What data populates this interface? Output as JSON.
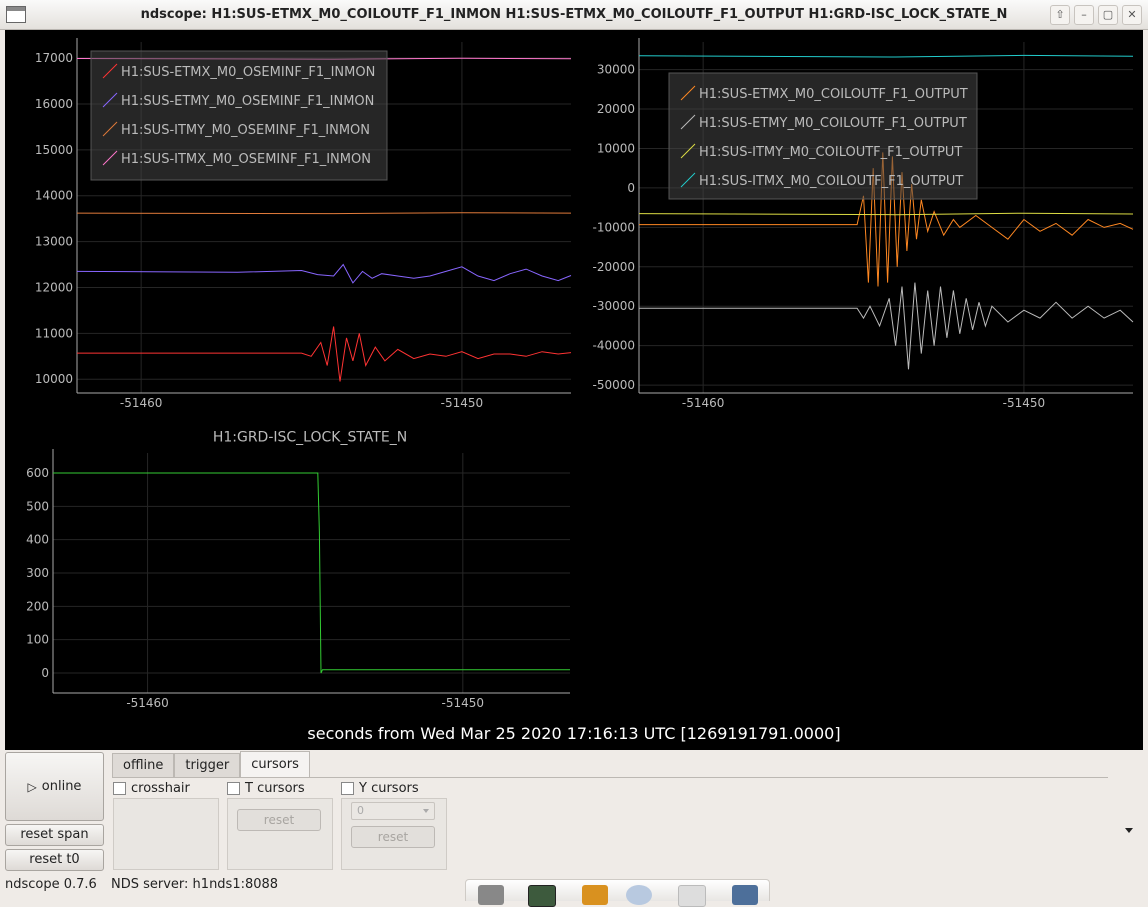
{
  "window": {
    "title": "ndscope: H1:SUS-ETMX_M0_COILOUTF_F1_INMON H1:SUS-ETMX_M0_COILOUTF_F1_OUTPUT H1:GRD-ISC_LOCK_STATE_N",
    "buttons": [
      "up-arrow-icon",
      "minimize-icon",
      "maximize-icon",
      "close-icon"
    ]
  },
  "time_axis_label": "seconds from Wed Mar 25 2020 17:16:13 UTC [1269191791.0000]",
  "controls": {
    "online_label": "online",
    "online_icon": "play-icon",
    "reset_span_label": "reset span",
    "reset_t0_label": "reset t0",
    "tabs": [
      "offline",
      "trigger",
      "cursors"
    ],
    "active_tab": "cursors",
    "crosshair_label": "crosshair",
    "t_cursors_label": "T cursors",
    "y_cursors_label": "Y cursors",
    "t_reset_label": "reset",
    "y_reset_label": "reset",
    "y_select_value": "0"
  },
  "status": {
    "version": "ndscope 0.7.6",
    "server": "NDS server: h1nds1:8088"
  },
  "chart_data": [
    {
      "type": "line",
      "title": "",
      "xlim": [
        -51462,
        -51446.6
      ],
      "ylim": [
        9700,
        17350
      ],
      "xticks": [
        -51460,
        -51450
      ],
      "yticks": [
        10000,
        11000,
        12000,
        13000,
        14000,
        15000,
        16000,
        17000
      ],
      "grid": true,
      "legend": "top-left",
      "series": [
        {
          "name": "H1:SUS-ETMX_M0_OSEMINF_F1_INMON",
          "color": "#ff3333",
          "x": [
            -51462,
            -51455,
            -51454.7,
            -51454.4,
            -51454.2,
            -51454.0,
            -51453.8,
            -51453.6,
            -51453.4,
            -51453.2,
            -51453.0,
            -51452.7,
            -51452.4,
            -51452.0,
            -51451.5,
            -51451.0,
            -51450.5,
            -51450.0,
            -51449.5,
            -51449.0,
            -51448.5,
            -51448.0,
            -51447.5,
            -51447.0,
            -51446.6
          ],
          "y": [
            10570,
            10570,
            10500,
            10800,
            10300,
            11150,
            9950,
            10900,
            10400,
            11000,
            10300,
            10700,
            10400,
            10650,
            10450,
            10550,
            10500,
            10600,
            10450,
            10550,
            10550,
            10500,
            10600,
            10550,
            10580
          ]
        },
        {
          "name": "H1:SUS-ETMY_M0_OSEMINF_F1_INMON",
          "color": "#8866ff",
          "x": [
            -51462,
            -51457,
            -51455,
            -51454.5,
            -51454,
            -51453.7,
            -51453.4,
            -51453.1,
            -51452.8,
            -51452.5,
            -51452,
            -51451.5,
            -51451,
            -51450.5,
            -51450,
            -51449.5,
            -51449,
            -51448.5,
            -51448,
            -51447.5,
            -51447,
            -51446.6
          ],
          "y": [
            12350,
            12330,
            12370,
            12280,
            12250,
            12500,
            12100,
            12350,
            12200,
            12300,
            12250,
            12200,
            12250,
            12350,
            12450,
            12250,
            12150,
            12300,
            12400,
            12250,
            12150,
            12260
          ]
        },
        {
          "name": "H1:SUS-ITMY_M0_OSEMINF_F1_INMON",
          "color": "#e07a3a",
          "x": [
            -51462,
            -51454,
            -51450,
            -51446.6
          ],
          "y": [
            13620,
            13610,
            13630,
            13620
          ]
        },
        {
          "name": "H1:SUS-ITMX_M0_OSEMINF_F1_INMON",
          "color": "#ff77cc",
          "x": [
            -51462,
            -51454,
            -51450,
            -51446.6
          ],
          "y": [
            16990,
            16975,
            16995,
            16985
          ]
        }
      ]
    },
    {
      "type": "line",
      "title": "",
      "xlim": [
        -51462,
        -51446.6
      ],
      "ylim": [
        -52000,
        37000
      ],
      "xticks": [
        -51460,
        -51450
      ],
      "yticks": [
        -50000,
        -40000,
        -30000,
        -20000,
        -10000,
        0,
        10000,
        20000,
        30000
      ],
      "grid": true,
      "legend": "top-left",
      "series": [
        {
          "name": "H1:SUS-ETMX_M0_COILOUTF_F1_OUTPUT",
          "color": "#ff8822",
          "x": [
            -51462,
            -51455.2,
            -51455.0,
            -51454.85,
            -51454.7,
            -51454.55,
            -51454.4,
            -51454.25,
            -51454.1,
            -51453.95,
            -51453.8,
            -51453.65,
            -51453.5,
            -51453.35,
            -51453.2,
            -51453.0,
            -51452.8,
            -51452.5,
            -51452.2,
            -51452.0,
            -51451.5,
            -51451.0,
            -51450.5,
            -51450.0,
            -51449.5,
            -51449.0,
            -51448.5,
            -51448.0,
            -51447.5,
            -51447.0,
            -51446.6
          ],
          "y": [
            -9300,
            -9300,
            -2000,
            -24000,
            5000,
            -25000,
            9000,
            -24000,
            8000,
            -20000,
            4000,
            -16000,
            1000,
            -13000,
            -3000,
            -11000,
            -6000,
            -12000,
            -8000,
            -10000,
            -7000,
            -10000,
            -13000,
            -8000,
            -11000,
            -9000,
            -12000,
            -8000,
            -10000,
            -9000,
            -10500
          ]
        },
        {
          "name": "H1:SUS-ETMY_M0_COILOUTF_F1_OUTPUT",
          "color": "#bbbbbb",
          "x": [
            -51462,
            -51455.2,
            -51455.0,
            -51454.8,
            -51454.5,
            -51454.2,
            -51454.0,
            -51453.8,
            -51453.6,
            -51453.4,
            -51453.2,
            -51453.0,
            -51452.8,
            -51452.6,
            -51452.4,
            -51452.2,
            -51452.0,
            -51451.8,
            -51451.6,
            -51451.4,
            -51451.2,
            -51451.0,
            -51450.5,
            -51450.0,
            -51449.5,
            -51449.0,
            -51448.5,
            -51448.0,
            -51447.5,
            -51447.0,
            -51446.6
          ],
          "y": [
            -30500,
            -30500,
            -33000,
            -30000,
            -35000,
            -28000,
            -40000,
            -25000,
            -46000,
            -24000,
            -42000,
            -26000,
            -40000,
            -25000,
            -38000,
            -26000,
            -37000,
            -28000,
            -36000,
            -29000,
            -35000,
            -30000,
            -34000,
            -31000,
            -33000,
            -29000,
            -33000,
            -30000,
            -33000,
            -31000,
            -34000
          ]
        },
        {
          "name": "H1:SUS-ITMY_M0_COILOUTF_F1_OUTPUT",
          "color": "#dddd44",
          "x": [
            -51462,
            -51454,
            -51450,
            -51446.6
          ],
          "y": [
            -6500,
            -6800,
            -6400,
            -6600
          ]
        },
        {
          "name": "H1:SUS-ITMX_M0_COILOUTF_F1_OUTPUT",
          "color": "#22cccc",
          "x": [
            -51462,
            -51454,
            -51450,
            -51446.6
          ],
          "y": [
            33500,
            33200,
            33600,
            33400
          ]
        }
      ]
    },
    {
      "type": "line",
      "title": "H1:GRD-ISC_LOCK_STATE_N",
      "xlim": [
        -51463,
        -51446.6
      ],
      "ylim": [
        -60,
        660
      ],
      "xticks": [
        -51460,
        -51450
      ],
      "yticks": [
        0,
        100,
        200,
        300,
        400,
        500,
        600
      ],
      "grid": true,
      "series": [
        {
          "name": "",
          "color": "#33cc33",
          "x": [
            -51463,
            -51454.6,
            -51454.55,
            -51454.5,
            -51454.45,
            -51446.6
          ],
          "y": [
            600,
            600,
            420,
            0,
            10,
            10
          ]
        }
      ]
    }
  ]
}
